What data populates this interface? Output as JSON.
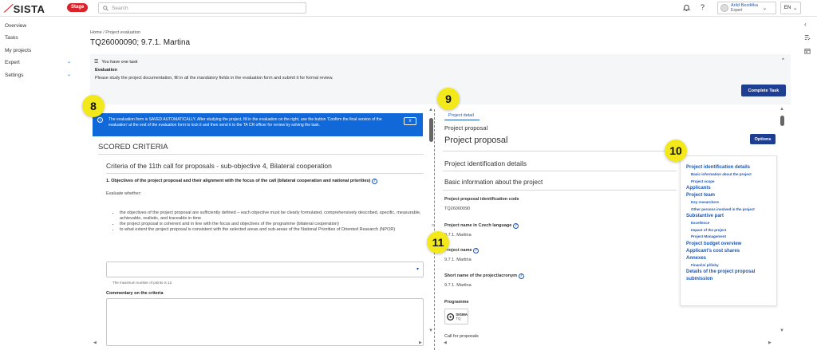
{
  "header": {
    "logo_text": "SISTA",
    "env_badge": "Stage",
    "search_placeholder": "Search",
    "user_name": "Arild Bezděka",
    "user_role": "Expert",
    "lang": "EN"
  },
  "sidebar": {
    "items": [
      {
        "label": "Overview",
        "expandable": false
      },
      {
        "label": "Tasks",
        "expandable": false
      },
      {
        "label": "My projects",
        "expandable": false
      },
      {
        "label": "Expert",
        "expandable": true
      },
      {
        "label": "Settings",
        "expandable": true
      }
    ]
  },
  "page": {
    "breadcrumb": "Home / Project evaluation",
    "title": "TQ26000090; 9.7.1. Martina"
  },
  "task": {
    "header": "You have one task",
    "name": "Evaluation",
    "instructions": "Please study the project documentation, fill in all the mandatory fields in the evaluation form and submit it for formal review.",
    "complete_button": "Complete Task"
  },
  "form": {
    "banner_text": "The evaluation form is SAVED AUTOMATICALLY. After studying the project, fill in the evaluation on the right, use the button 'Confirm the final version of the evaluation' at the end of the evaluation form to lock it and then send it to the TA CR officer for review by solving the task.",
    "banner_close": "X",
    "section_title": "SCORED CRITERIA",
    "criteria_title": "Criteria of the 11th call for proposals - sub-objective 4, Bilateral cooperation",
    "question": "1. Objectives of the project proposal and their alignment with the focus of the call (bilateral cooperation and national priorities)",
    "evaluate_label": "Evaluate whether:",
    "bullets": [
      "the objectives of the project proposal are sufficiently defined – each objective must be clearly formulated, comprehensively described, specific, measurable, achievable, realistic, and traceable in time",
      "the project proposal is coherent and in line with the focus and objectives of the programme (bilateral cooperation)",
      "to what extent the project proposal is consistent with the selected areas and sub-areas of the National Priorities of Oriented Research (NPOR)"
    ],
    "points_hint": "The maximum number of points is 12.",
    "commentary_label": "Commentary on the criteria"
  },
  "detail": {
    "tab": "Project detail",
    "subtitle": "Project proposal",
    "title": "Project proposal",
    "options_button": "Options",
    "section1": "Project identification details",
    "section2": "Basic information about the project",
    "fields": [
      {
        "label": "Project proposal identification code",
        "value": "TQ26000090",
        "help": false
      },
      {
        "label": "Project name in Czech language",
        "value": "9.7.1. Martina",
        "help": true
      },
      {
        "label": "Project name",
        "value": "9.7.1. Martina",
        "help": true
      },
      {
        "label": "Short name of the project/acronym",
        "value": "9.7.1. Martina",
        "help": true
      }
    ],
    "programme_label": "Programme",
    "programme_name": "SIGMA",
    "programme_code": "TQ",
    "call_label": "Call for proposals"
  },
  "toc": {
    "items": [
      {
        "text": "Project identification details",
        "level": 1
      },
      {
        "text": "Basic information about the project",
        "level": 2
      },
      {
        "text": "Project scope",
        "level": 2
      },
      {
        "text": "Applicants",
        "level": 1
      },
      {
        "text": "Project team",
        "level": 1
      },
      {
        "text": "Key researchers",
        "level": 2
      },
      {
        "text": "Other persons involved in the project",
        "level": 2
      },
      {
        "text": "Substantive part",
        "level": 1
      },
      {
        "text": "Excellence",
        "level": 2
      },
      {
        "text": "Impact of the project",
        "level": 2
      },
      {
        "text": "Project Management",
        "level": 2
      },
      {
        "text": "Project budget overview",
        "level": 1
      },
      {
        "text": "Applicant's cost shares",
        "level": 1
      },
      {
        "text": "Annexes",
        "level": 1
      },
      {
        "text": "Finanční přílohy",
        "level": 2
      },
      {
        "text": "Details of the project proposal submission",
        "level": 1
      }
    ]
  },
  "callouts": [
    "8",
    "9",
    "10",
    "11"
  ],
  "colors": {
    "brand_red": "#d8232a",
    "primary": "#1e3f91",
    "link": "#1d57b5",
    "banner": "#1068d9",
    "callout": "#f2e81a"
  }
}
